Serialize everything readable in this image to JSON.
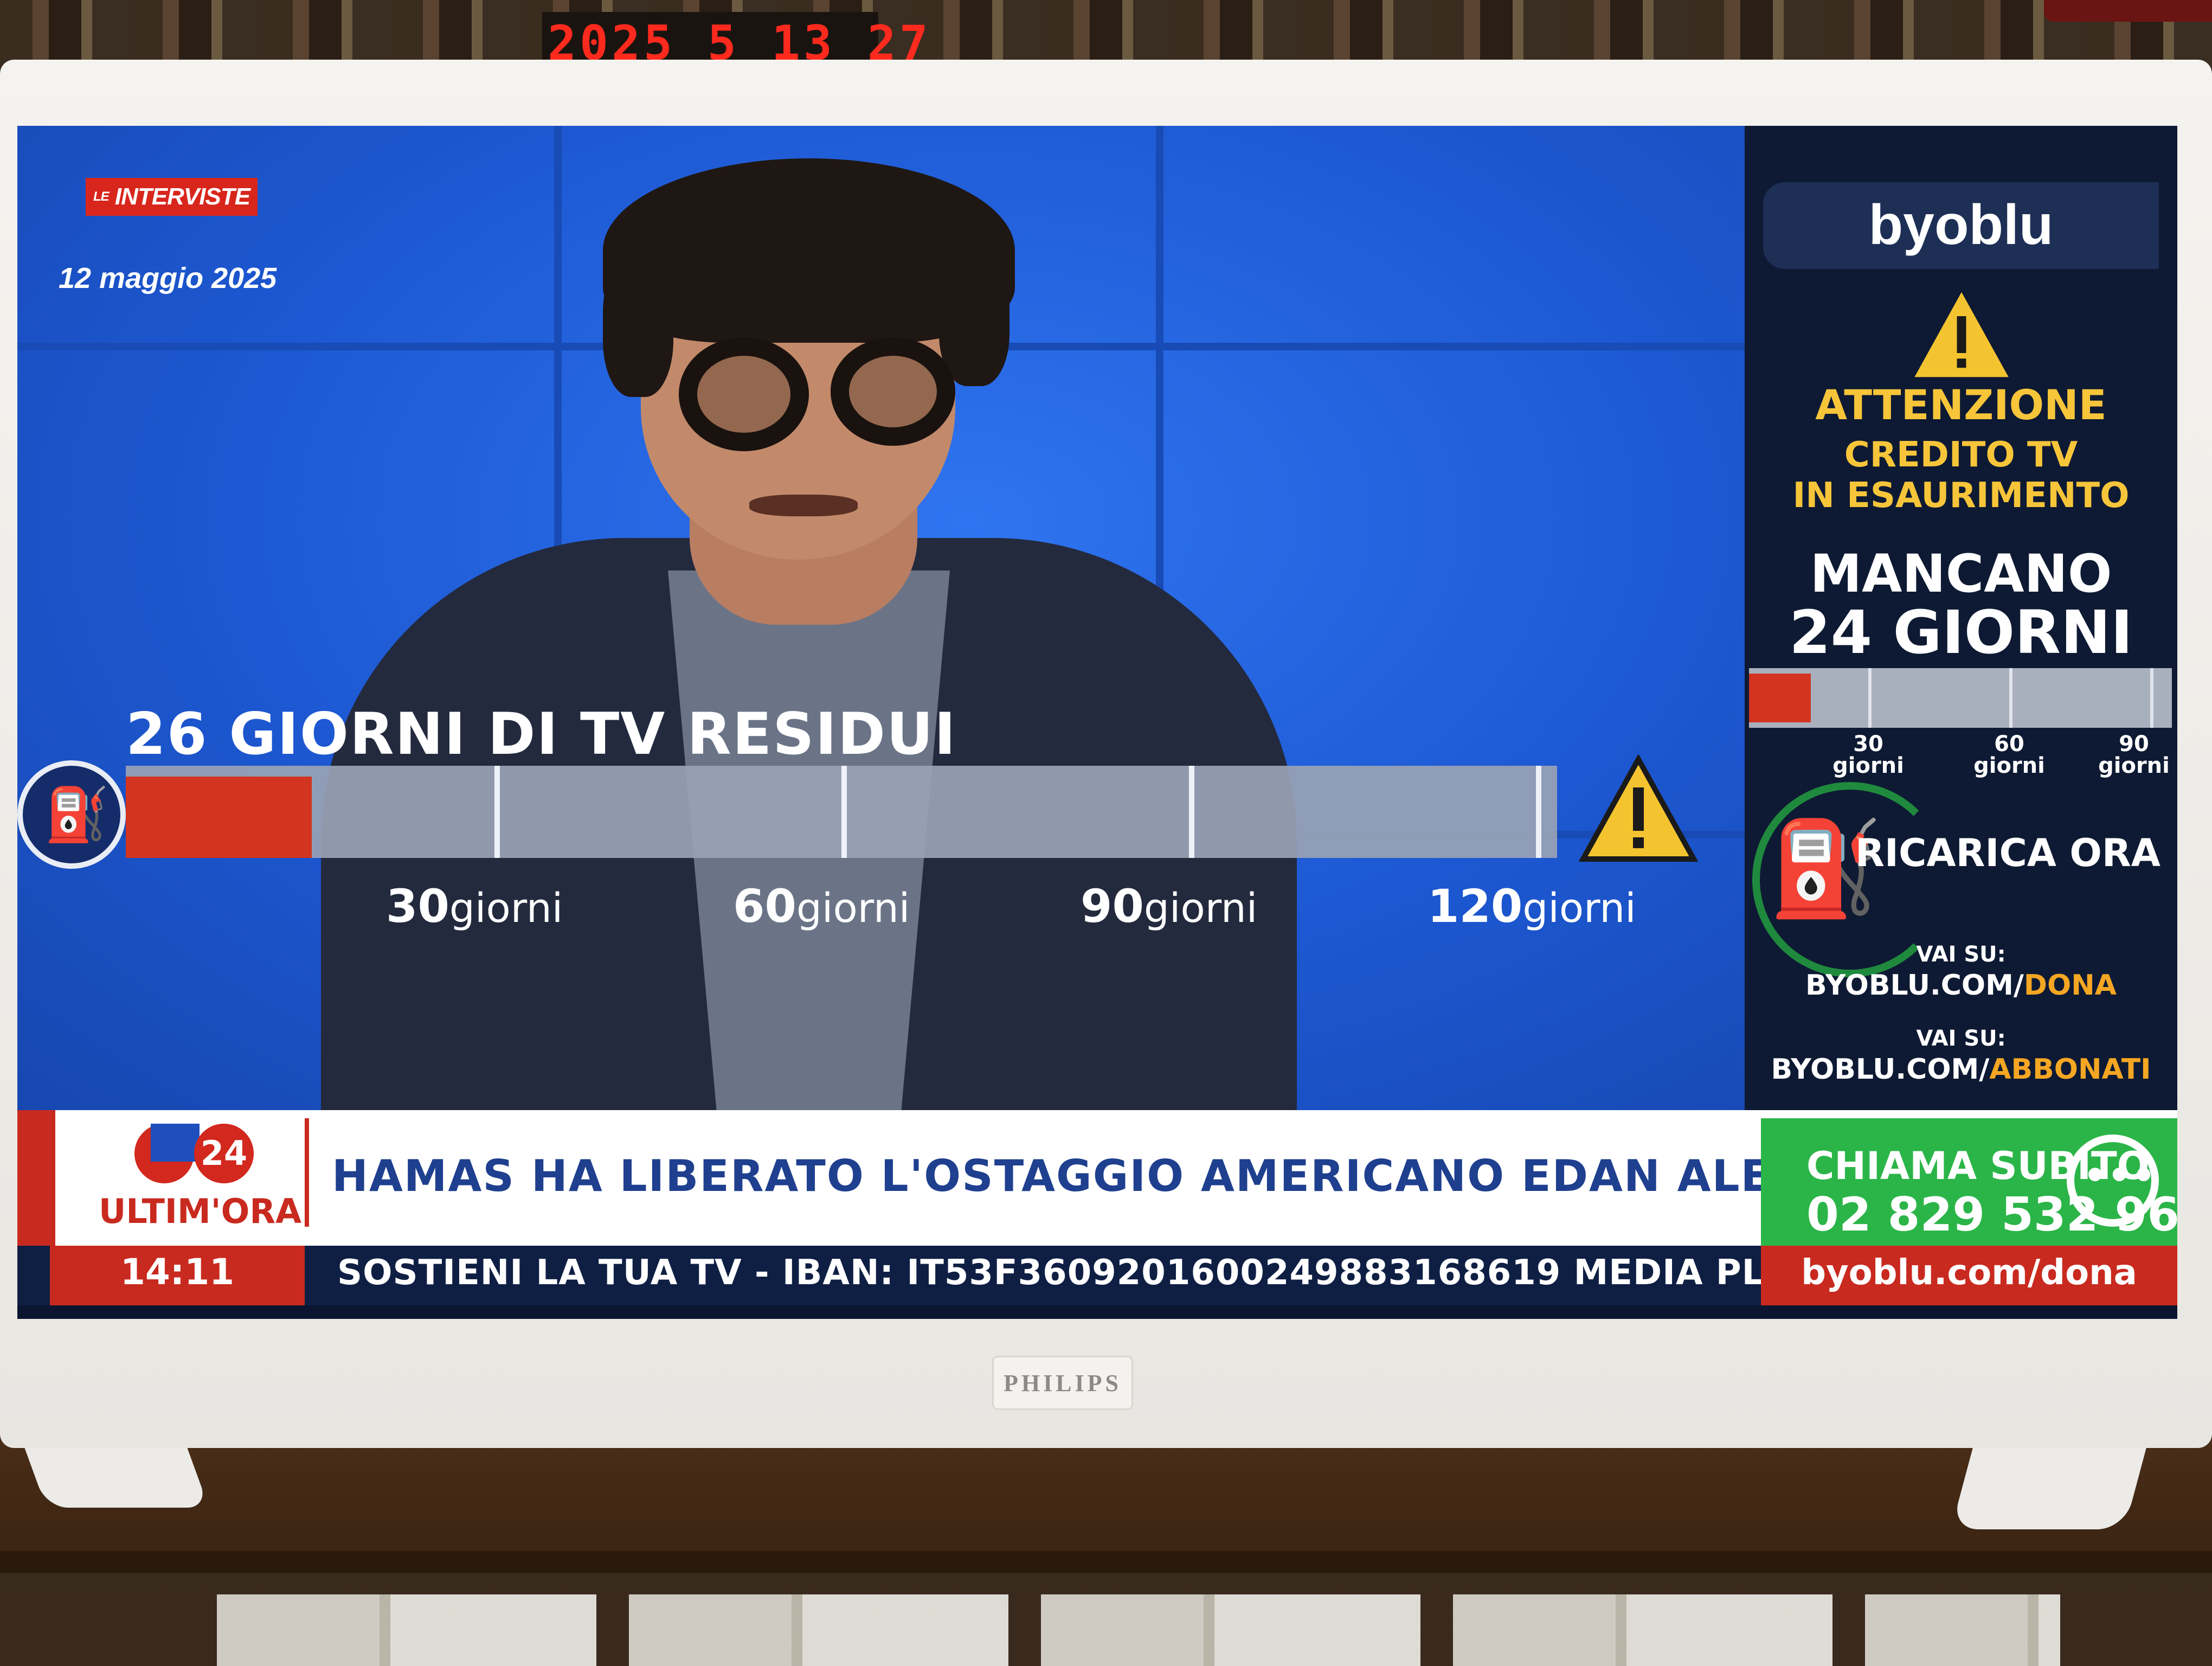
{
  "room": {
    "clock_text": "2025 5 13 27"
  },
  "tv": {
    "brand": "PHILIPS"
  },
  "broadcast": {
    "show_logo_small": "LE",
    "show_logo": "INTERVISTE",
    "date": "12 maggio 2025",
    "credit_bar": {
      "title": "26 GIORNI DI TV RESIDUI",
      "remaining_days": 26,
      "max_days": 120,
      "ticks": [
        {
          "num": "30",
          "unit": "giorni",
          "days": 30
        },
        {
          "num": "60",
          "unit": "giorni",
          "days": 60
        },
        {
          "num": "90",
          "unit": "giorni",
          "days": 90
        },
        {
          "num": "120",
          "unit": "giorni",
          "days": 120
        }
      ],
      "icons": {
        "left": "fuel-pump-icon",
        "right": "warning-icon"
      },
      "colors": {
        "fill": "#d33420",
        "track": "#9aa3b5"
      }
    },
    "side_panel": {
      "logo": "byoblu",
      "warning_title": "ATTENZIONE",
      "warning_line1": "CREDITO TV",
      "warning_line2": "IN ESAURIMENTO",
      "countdown_line1": "MANCANO",
      "countdown_line2": "24 GIORNI",
      "bar_remaining_days": 24,
      "bar_max_days": 90,
      "ticks": [
        {
          "num": "30",
          "unit": "giorni",
          "days": 30
        },
        {
          "num": "60",
          "unit": "giorni",
          "days": 60
        },
        {
          "num": "90",
          "unit": "giorni",
          "days": 90
        }
      ],
      "cta": "RICARICA ORA",
      "vai_su_1": "VAI SU:",
      "url_1_base": "BYOBLU.COM/",
      "url_1_path": "DONA",
      "vai_su_2": "VAI SU:",
      "url_2_base": "BYOBLU.COM/",
      "url_2_path": "ABBONATI",
      "accent": "#f5a623"
    },
    "lower_third": {
      "badge_number": "24",
      "label": "ULTIM'ORA",
      "headline": "HAMAS HA LIBERATO L'OSTAGGIO AMERICANO EDAN ALEXANDER",
      "cta_line1": "CHIAMA SUBITO",
      "cta_line2": "02 829 532 96",
      "time": "14:11",
      "crawl": "SOSTIENI LA TUA TV - IBAN: IT53F3609201600249883168619 MEDIA PLURALISM EUROPE SPA",
      "url": "byoblu.com/dona"
    }
  }
}
